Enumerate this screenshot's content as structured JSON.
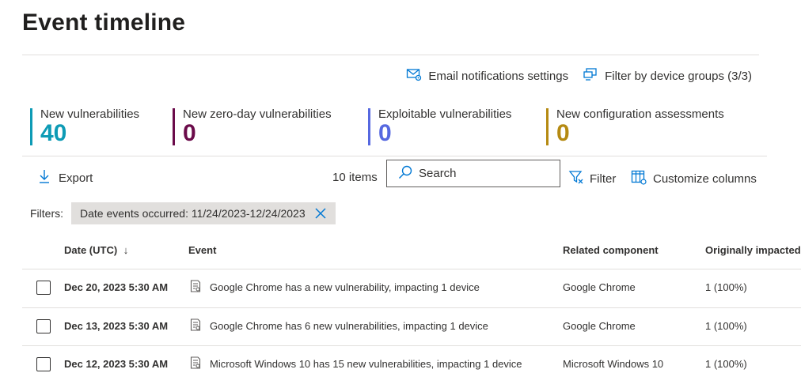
{
  "page": {
    "title": "Event timeline"
  },
  "top_links": {
    "email_settings": "Email notifications settings",
    "device_groups": "Filter by device groups (3/3)"
  },
  "stats": [
    {
      "label": "New vulnerabilities",
      "value": "40",
      "color": "#0e9bb5"
    },
    {
      "label": "New zero-day vulnerabilities",
      "value": "0",
      "color": "#6b0b4a"
    },
    {
      "label": "Exploitable vulnerabilities",
      "value": "0",
      "color": "#5668e0"
    },
    {
      "label": "New configuration assessments",
      "value": "0",
      "color": "#b58a12"
    }
  ],
  "toolbar": {
    "export_label": "Export",
    "items_count": "10 items",
    "search_placeholder": "Search",
    "filter_label": "Filter",
    "customize_label": "Customize columns"
  },
  "filters": {
    "label": "Filters:",
    "chips": [
      {
        "text": "Date events occurred: 11/24/2023-12/24/2023"
      }
    ]
  },
  "table": {
    "columns": [
      "Date (UTC)",
      "Event",
      "Related component",
      "Originally impacted"
    ],
    "sort_indicator": "↓",
    "rows": [
      {
        "date": "Dec 20, 2023 5:30 AM",
        "event": "Google Chrome has a new vulnerability, impacting 1 device",
        "component": "Google Chrome",
        "impacted": "1 (100%)"
      },
      {
        "date": "Dec 13, 2023 5:30 AM",
        "event": "Google Chrome has 6 new vulnerabilities, impacting 1 device",
        "component": "Google Chrome",
        "impacted": "1 (100%)"
      },
      {
        "date": "Dec 12, 2023 5:30 AM",
        "event": "Microsoft Windows 10 has 15 new vulnerabilities, impacting 1 device",
        "component": "Microsoft Windows 10",
        "impacted": "1 (100%)"
      }
    ]
  },
  "colors": {
    "accent": "#0078d4",
    "border": "#e1dfdd",
    "text": "#323130"
  }
}
